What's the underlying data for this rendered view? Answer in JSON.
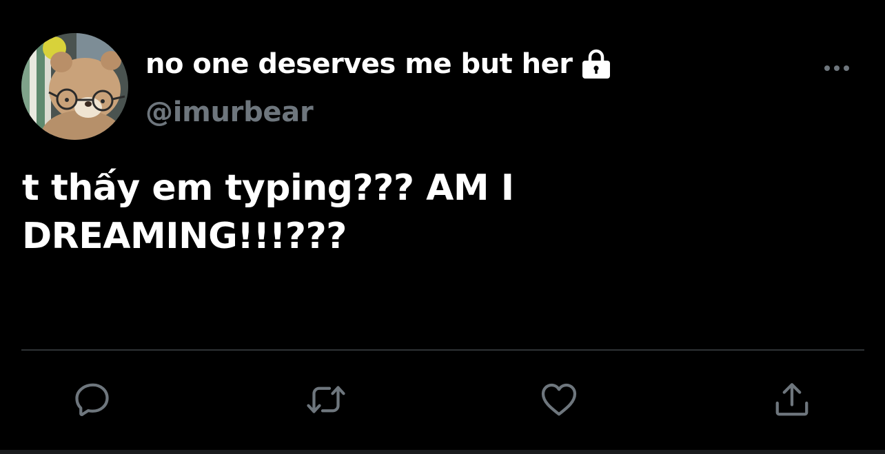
{
  "tweet": {
    "display_name": "no one deserves me but her",
    "handle": "@imurbear",
    "text": "t thấy em typing??? AM I\nDREAMING!!!???",
    "protected": true
  },
  "icons": {
    "lock": "lock-icon",
    "more": "more-horizontal-icon",
    "reply": "reply-icon",
    "retweet": "retweet-icon",
    "like": "heart-icon",
    "share": "share-icon"
  },
  "colors": {
    "background": "#000000",
    "text_primary": "#ffffff",
    "text_secondary": "#6e767d",
    "divider": "#2f3336",
    "icon": "#6e767d"
  }
}
